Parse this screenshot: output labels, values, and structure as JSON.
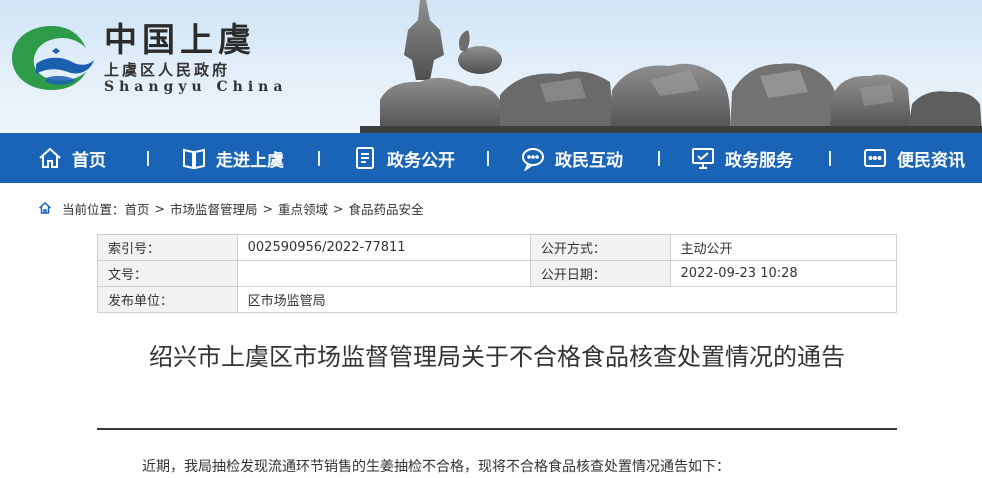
{
  "site": {
    "logo_cn": "中国上虞",
    "logo_sub": "上虞区人民政府",
    "logo_en": "Shangyu China"
  },
  "colors": {
    "nav_bg": "#1a64b7",
    "banner_sky": "#cfe4f6",
    "logo_green": "#2e9b48",
    "logo_blue": "#1b5fb1"
  },
  "nav": {
    "items": [
      {
        "label": "首页",
        "icon": "home-icon"
      },
      {
        "label": "走进上虞",
        "icon": "book-icon"
      },
      {
        "label": "政务公开",
        "icon": "document-icon"
      },
      {
        "label": "政民互动",
        "icon": "chat-icon"
      },
      {
        "label": "政务服务",
        "icon": "monitor-icon"
      },
      {
        "label": "便民资讯",
        "icon": "message-icon"
      }
    ]
  },
  "breadcrumb": {
    "prefix": "当前位置：",
    "items": [
      "首页",
      "市场监督管理局",
      "重点领域",
      "食品药品安全"
    ],
    "separator": ">"
  },
  "info": {
    "index_label": "索引号：",
    "index_value": "002590956/2022-77811",
    "publish_mode_label": "公开方式：",
    "publish_mode_value": "主动公开",
    "doc_no_label": "文号：",
    "doc_no_value": "",
    "publish_date_label": "公开日期：",
    "publish_date_value": "2022-09-23 10:28",
    "issuer_label": "发布单位：",
    "issuer_value": "区市场监管局"
  },
  "article": {
    "title": "绍兴市上虞区市场监督管理局关于不合格食品核查处置情况的通告",
    "paragraph": "近期，我局抽检发现流通环节销售的生姜抽检不合格，现将不合格食品核查处置情况通告如下："
  }
}
